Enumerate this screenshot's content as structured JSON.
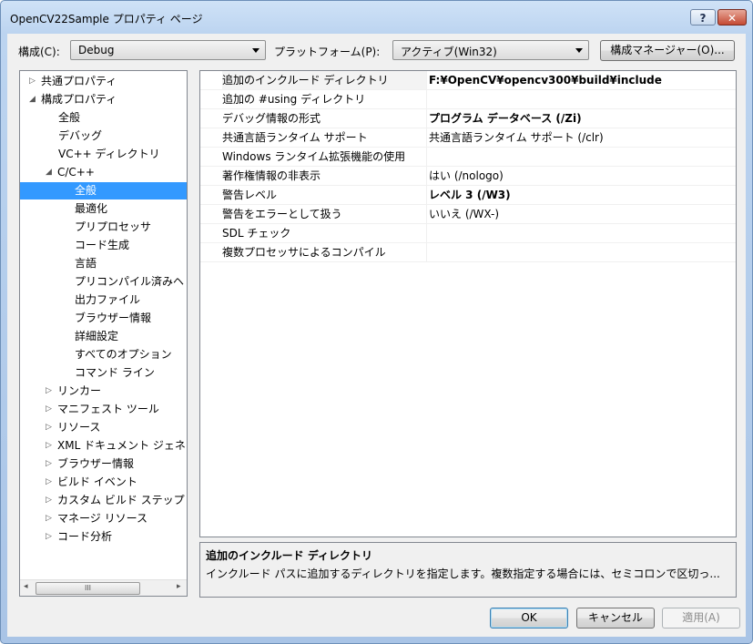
{
  "window": {
    "title": "OpenCV22Sample プロパティ ページ",
    "help_label": "?",
    "close_label": "✕"
  },
  "top": {
    "config_label": "構成(C):",
    "config_value": "Debug",
    "platform_label": "プラットフォーム(P):",
    "platform_value": "アクティブ(Win32)",
    "manager_label": "構成マネージャー(O)..."
  },
  "tree": {
    "items": [
      {
        "label": "共通プロパティ",
        "expander": "▷"
      },
      {
        "label": "構成プロパティ",
        "expander": "◢"
      },
      {
        "label": "全般",
        "expander": ""
      },
      {
        "label": "デバッグ",
        "expander": ""
      },
      {
        "label": "VC++ ディレクトリ",
        "expander": ""
      },
      {
        "label": "C/C++",
        "expander": "◢"
      },
      {
        "label": "全般",
        "expander": ""
      },
      {
        "label": "最適化",
        "expander": ""
      },
      {
        "label": "プリプロセッサ",
        "expander": ""
      },
      {
        "label": "コード生成",
        "expander": ""
      },
      {
        "label": "言語",
        "expander": ""
      },
      {
        "label": "プリコンパイル済みヘ",
        "expander": ""
      },
      {
        "label": "出力ファイル",
        "expander": ""
      },
      {
        "label": "ブラウザー情報",
        "expander": ""
      },
      {
        "label": "詳細設定",
        "expander": ""
      },
      {
        "label": "すべてのオプション",
        "expander": ""
      },
      {
        "label": "コマンド ライン",
        "expander": ""
      },
      {
        "label": "リンカー",
        "expander": "▷"
      },
      {
        "label": "マニフェスト ツール",
        "expander": "▷"
      },
      {
        "label": "リソース",
        "expander": "▷"
      },
      {
        "label": "XML ドキュメント ジェネ",
        "expander": "▷"
      },
      {
        "label": "ブラウザー情報",
        "expander": "▷"
      },
      {
        "label": "ビルド イベント",
        "expander": "▷"
      },
      {
        "label": "カスタム ビルド ステップ",
        "expander": "▷"
      },
      {
        "label": "マネージ リソース",
        "expander": "▷"
      },
      {
        "label": "コード分析",
        "expander": "▷"
      }
    ],
    "scroll_left": "◂",
    "scroll_right": "▸",
    "scroll_grip": "III"
  },
  "properties": [
    {
      "name": "追加のインクルード ディレクトリ",
      "value": "F:¥OpenCV¥opencv300¥build¥include",
      "bold": true
    },
    {
      "name": "追加の #using ディレクトリ",
      "value": "",
      "bold": false
    },
    {
      "name": "デバッグ情報の形式",
      "value": "プログラム データベース (/Zi)",
      "bold": true
    },
    {
      "name": "共通言語ランタイム サポート",
      "value": "共通言語ランタイム サポート (/clr)",
      "bold": false
    },
    {
      "name": "Windows ランタイム拡張機能の使用",
      "value": "",
      "bold": false
    },
    {
      "name": "著作権情報の非表示",
      "value": "はい (/nologo)",
      "bold": false
    },
    {
      "name": "警告レベル",
      "value": "レベル 3 (/W3)",
      "bold": true
    },
    {
      "name": "警告をエラーとして扱う",
      "value": "いいえ (/WX-)",
      "bold": false
    },
    {
      "name": "SDL チェック",
      "value": "",
      "bold": false
    },
    {
      "name": "複数プロセッサによるコンパイル",
      "value": "",
      "bold": false
    }
  ],
  "description": {
    "title": "追加のインクルード ディレクトリ",
    "text": "インクルード パスに追加するディレクトリを指定します。複数指定する場合には、セミコロンで区切っ..."
  },
  "buttons": {
    "ok": "OK",
    "cancel": "キャンセル",
    "apply": "適用(A)"
  }
}
